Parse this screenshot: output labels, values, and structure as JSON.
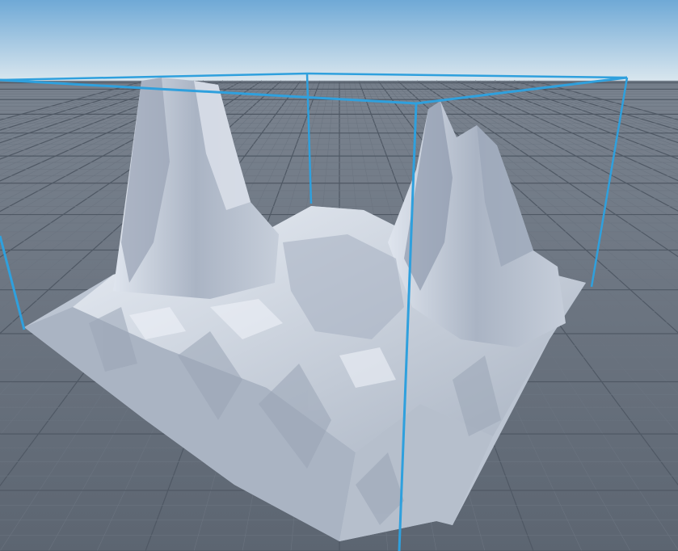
{
  "viewport": {
    "sky_top_color": "#6fa9d6",
    "sky_horizon_color": "#d9e6ee",
    "ground_color": "#5c6571",
    "grid_line_color": "#6b7480",
    "grid_major_color": "#4f5864"
  },
  "terrain": {
    "material": "snow",
    "base_color": "#c9d1dd",
    "shadow_color": "#7f8a9c",
    "highlight_color": "#e9eef5"
  },
  "selection_box": {
    "color": "#2fa0dd",
    "selected": true
  },
  "icons": {
    "selection": "selection-box-icon"
  }
}
